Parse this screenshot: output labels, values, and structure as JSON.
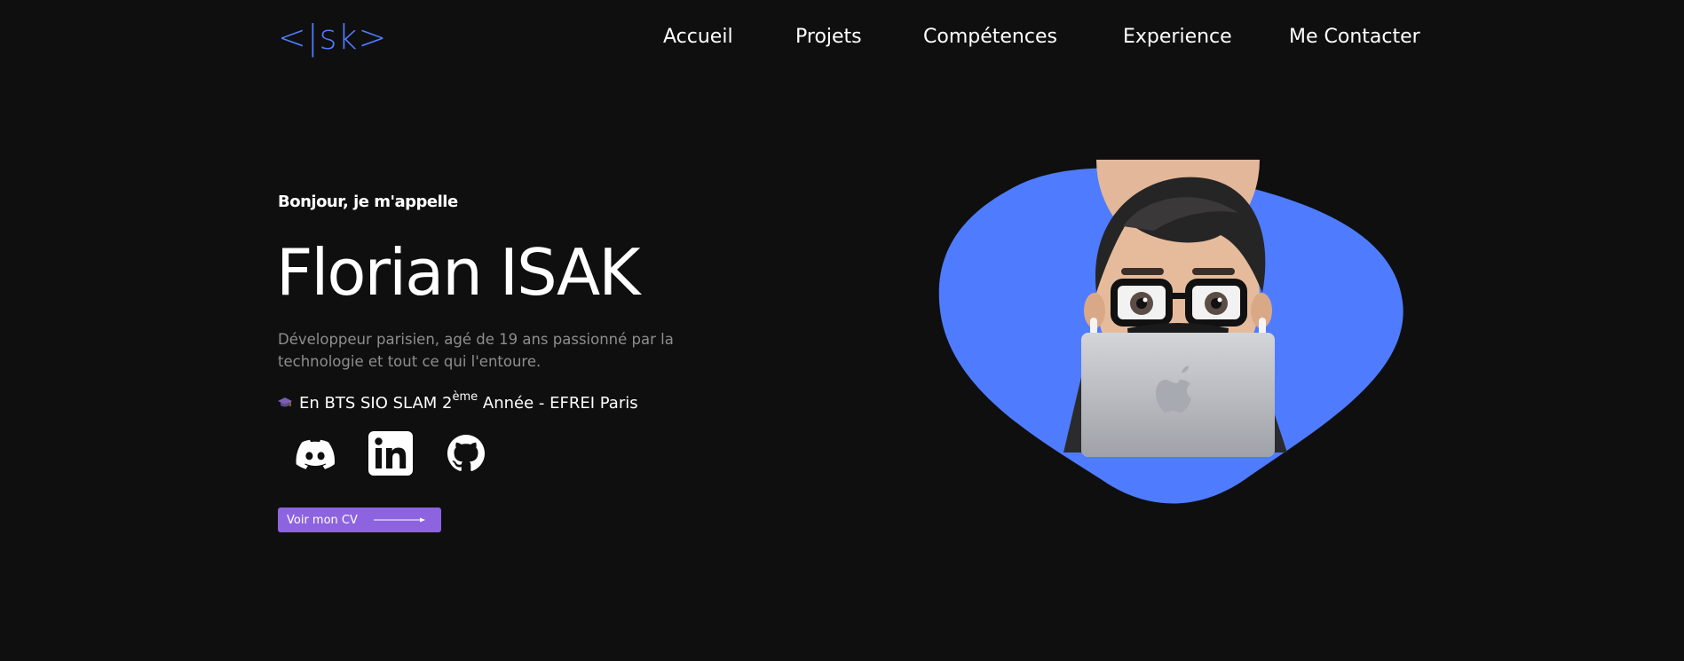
{
  "header": {
    "logo_text": "<|sk>",
    "nav": [
      "Accueil",
      "Projets",
      "Compétences",
      "Experience",
      "Me Contacter"
    ]
  },
  "hero": {
    "greeting": "Bonjour, je m'appelle",
    "name": "Florian ISAK",
    "bio": "Développeur parisien, agé de 19 ans passionné par la technologie et tout ce qui l'entoure.",
    "study": {
      "prefix": "En BTS SIO SLAM 2",
      "sup": "ème",
      "suffix": " Année - EFREI Paris"
    },
    "socials": [
      "discord-icon",
      "linkedin-icon",
      "github-icon"
    ],
    "cv_button": "Voir mon CV",
    "avatar_icon": "memoji-with-laptop"
  },
  "colors": {
    "background": "#0f0f0f",
    "accent_blue": "#4f7cff",
    "button_purple": "#8d63e0",
    "muted_text": "#8e8e8e"
  }
}
